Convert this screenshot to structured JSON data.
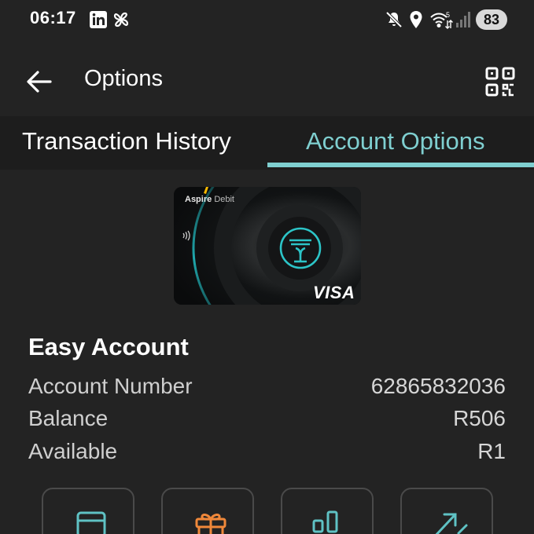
{
  "status_bar": {
    "time": "06:17",
    "battery": "83",
    "icons": [
      "linkedin-icon",
      "pinwheel-icon",
      "mute-icon",
      "location-icon",
      "wifi-5g-icon",
      "signal-icon"
    ]
  },
  "app_bar": {
    "title": "Options",
    "back_icon": "arrow-left-icon",
    "qr_icon": "qr-code-icon"
  },
  "tabs": [
    {
      "label": "Transaction History",
      "selected": false
    },
    {
      "label": "Account Options",
      "selected": true
    }
  ],
  "card": {
    "brand": "Aspire",
    "product": "Debit",
    "network": "VISA",
    "contactless_icon": "contactless-icon",
    "logo_icon": "bank-tree-logo-icon"
  },
  "account": {
    "name": "Easy Account",
    "rows": [
      {
        "label": "Account Number",
        "value": "62865832036"
      },
      {
        "label": "Balance",
        "value": "R506"
      },
      {
        "label": "Available",
        "value": "R1"
      }
    ]
  },
  "actions": [
    {
      "icon": "card-icon",
      "color": "#5fc2c4"
    },
    {
      "icon": "gift-icon",
      "color": "#f0883a"
    },
    {
      "icon": "bar-chart-icon",
      "color": "#5fc2c4"
    },
    {
      "icon": "transfer-arrows-icon",
      "color": "#5fc2c4"
    }
  ],
  "colors": {
    "background": "#232323",
    "accent": "#7fcfd0",
    "text": "#ffffff"
  }
}
